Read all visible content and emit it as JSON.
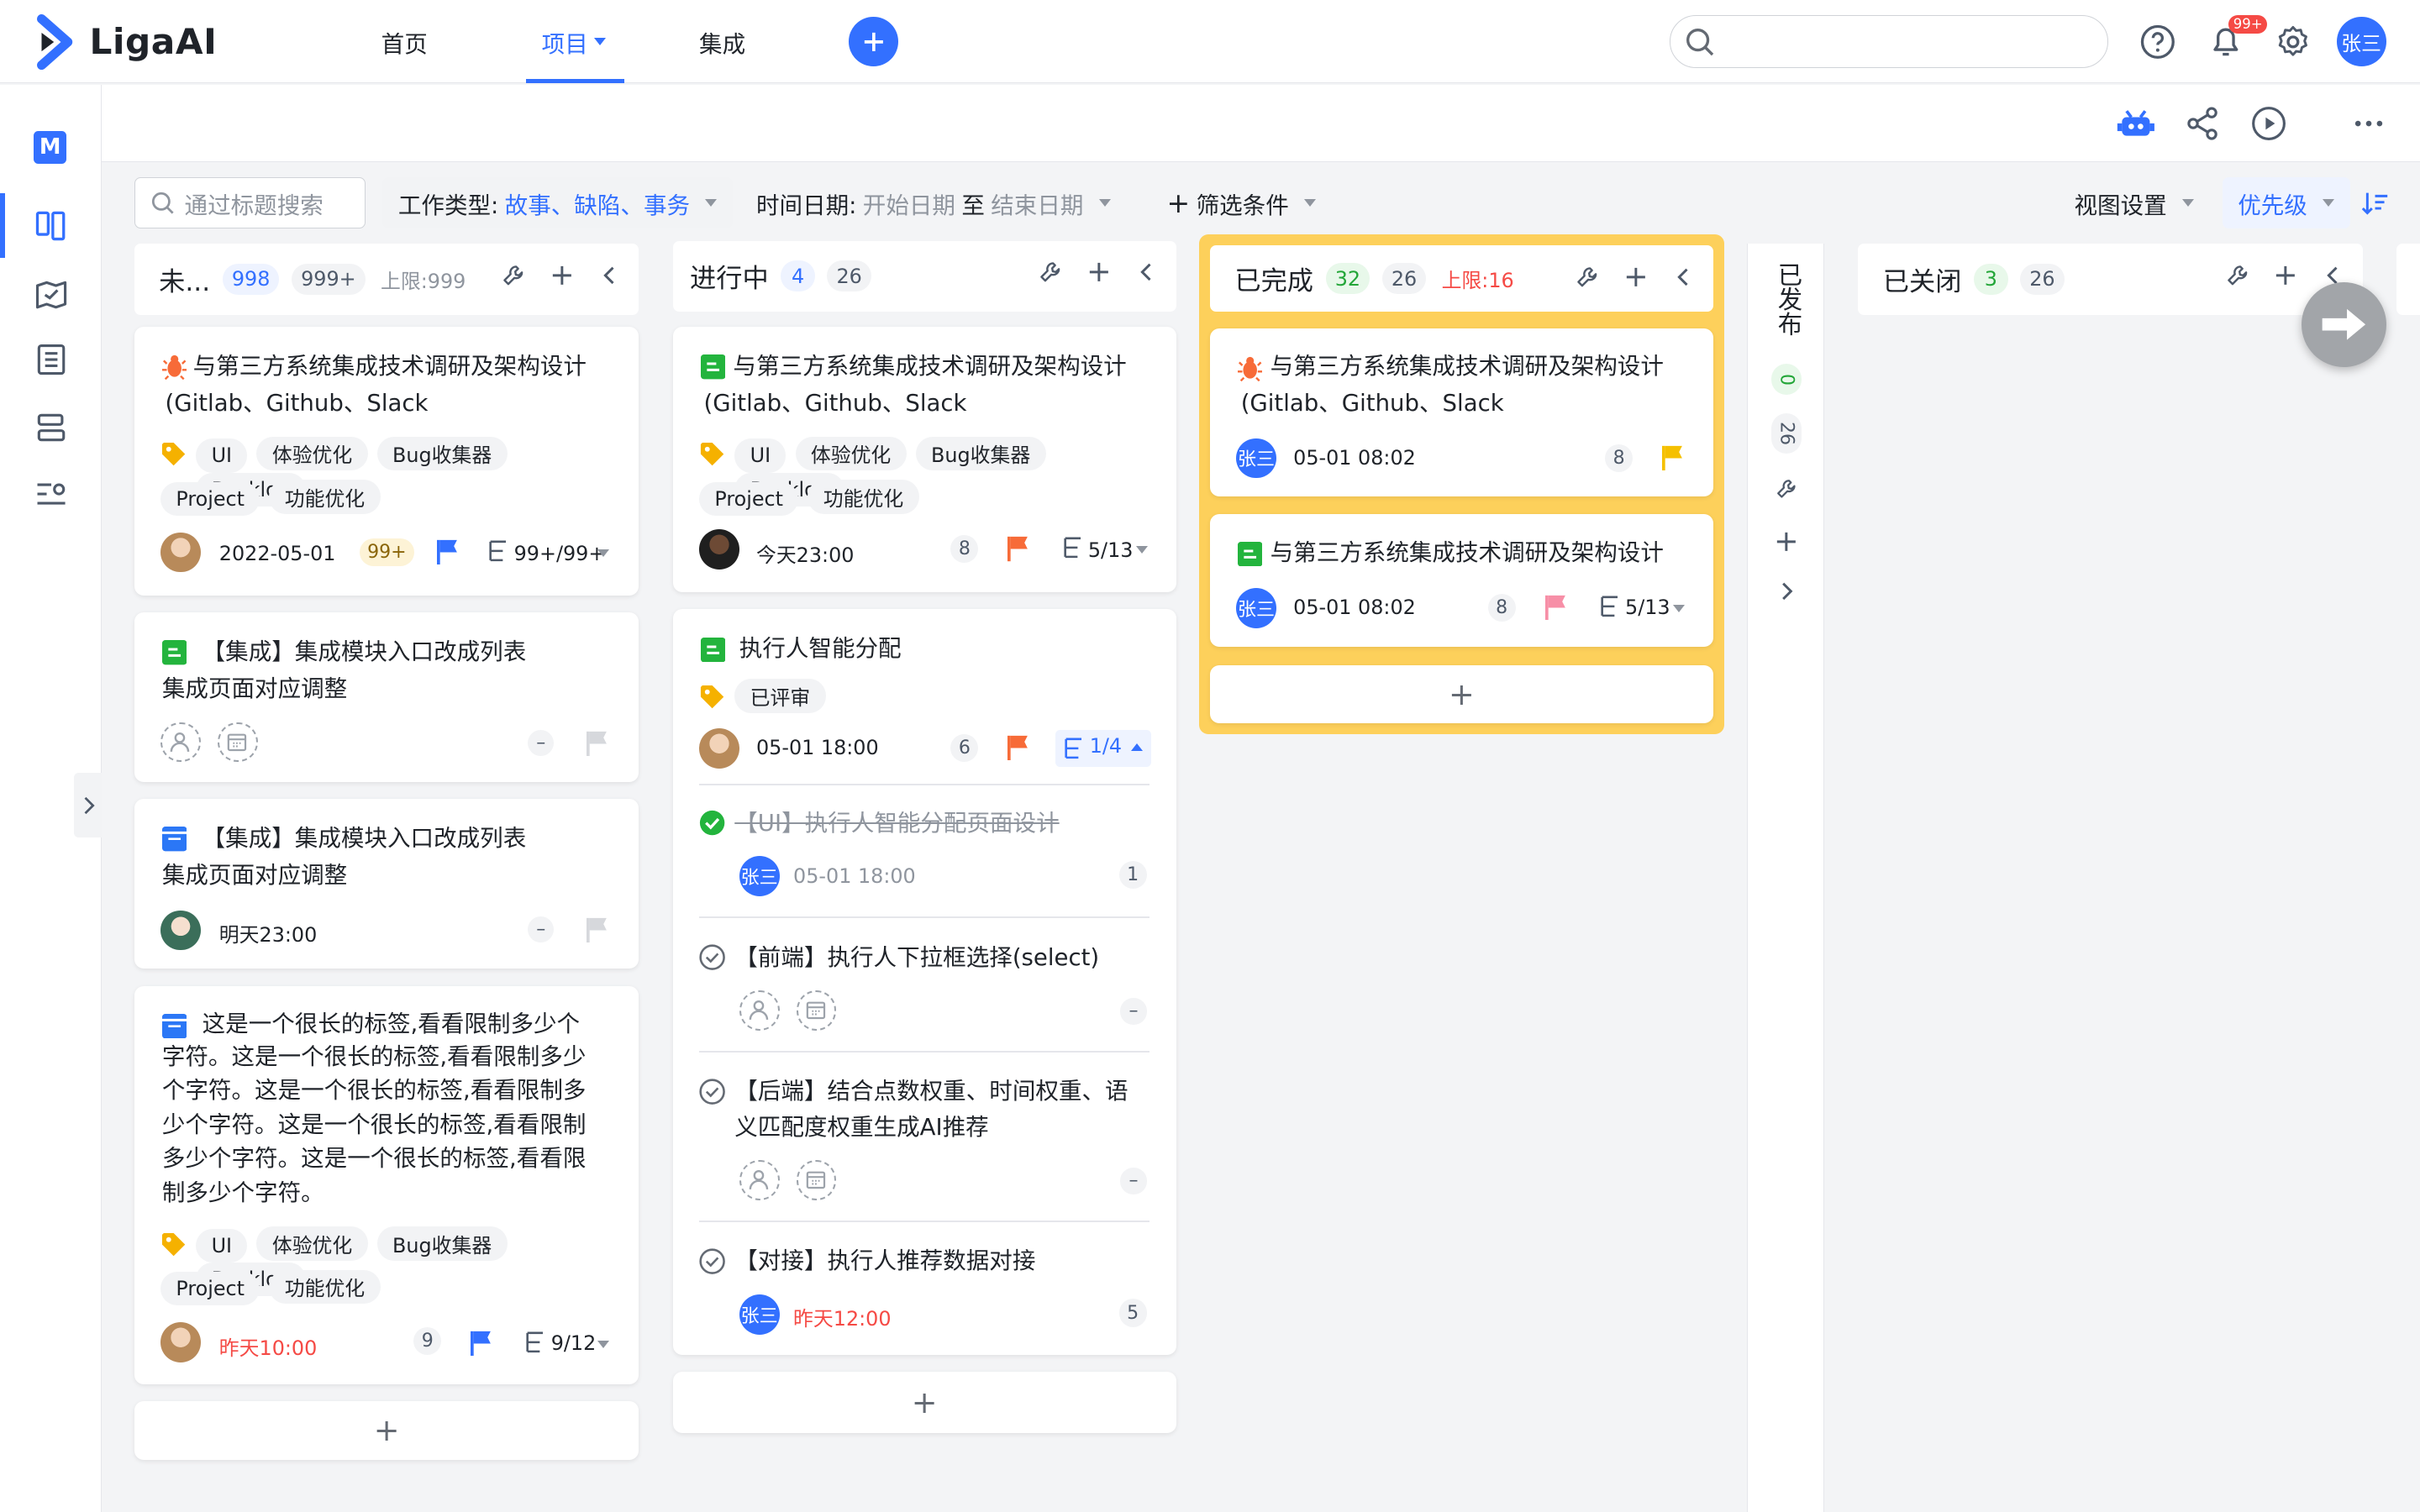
{
  "app": {
    "name": "LigaAI"
  },
  "nav": {
    "home": "首页",
    "project": "项目",
    "integration": "集成"
  },
  "header": {
    "notification_badge": "99+",
    "user_avatar": "张三"
  },
  "rail": {
    "project_badge": "M"
  },
  "filters": {
    "search_placeholder": "通过标题搜索",
    "work_type_label": "工作类型:",
    "work_type_value": "故事、缺陷、事务",
    "date_label": "时间日期:",
    "date_start": "开始日期",
    "date_to": "至",
    "date_end": "结束日期",
    "filter_conditions": "筛选条件",
    "view_settings": "视图设置",
    "sort_priority": "优先级"
  },
  "columns": {
    "todo": {
      "title": "未...",
      "count": "998",
      "count2": "999+",
      "limit": "上限:999"
    },
    "doing": {
      "title": "进行中",
      "count": "4",
      "count2": "26"
    },
    "done": {
      "title": "已完成",
      "count": "32",
      "count2": "26",
      "limit": "上限:16"
    },
    "released": {
      "title": "已发布",
      "count": "0",
      "count2": "26"
    },
    "closed": {
      "title": "已关闭",
      "count": "3",
      "count2": "26"
    }
  },
  "cards": {
    "c1": {
      "title_l1": "与第三方系统集成技术调研及架构设计",
      "title_l2": "(Gitlab、Github、Slack",
      "tags": [
        "UI",
        "体验优化",
        "Bug收集器",
        "Backlog",
        "Project",
        "功能优化"
      ],
      "date": "2022-05-01",
      "badge": "99+",
      "subtasks": "99+/99+"
    },
    "c2": {
      "title_l1": "【集成】集成模块入口改成列表",
      "title_l2": "集成页面对应调整",
      "dash": "–"
    },
    "c3": {
      "title_l1": "【集成】集成模块入口改成列表",
      "title_l2": "集成页面对应调整",
      "date": "明天23:00",
      "dash": "–"
    },
    "c4": {
      "title_lines": [
        "这是一个很长的标签,看看限制多少个",
        "字符。这是一个很长的标签,看看限制多少",
        "个字符。这是一个很长的标签,看看限制多",
        "少个字符。这是一个很长的标签,看看限制",
        "多少个字符。这是一个很长的标签,看看限",
        "制多少个字符。"
      ],
      "tags": [
        "UI",
        "体验优化",
        "Bug收集器",
        "Backlog",
        "Project",
        "功能优化"
      ],
      "date": "昨天10:00",
      "badge": "9",
      "subtasks": "9/12"
    },
    "d1": {
      "title_l1": "与第三方系统集成技术调研及架构设计",
      "title_l2": "(Gitlab、Github、Slack",
      "tags": [
        "UI",
        "体验优化",
        "Bug收集器",
        "Backlog",
        "Project",
        "功能优化"
      ],
      "date": "今天23:00",
      "badge": "8",
      "subtasks": "5/13"
    },
    "d2": {
      "title": "执行人智能分配",
      "tag": "已评审",
      "date": "05-01 18:00",
      "badge": "6",
      "subtasks": "1/4",
      "subs": [
        {
          "title": "【UI】执行人智能分配页面设计",
          "avatar": "张三",
          "date": "05-01 18:00",
          "badge": "1"
        },
        {
          "title": "【前端】执行人下拉框选择(select)",
          "dash": "–"
        },
        {
          "title_l1": "【后端】结合点数权重、时间权重、语",
          "title_l2": "义匹配度权重生成AI推荐",
          "dash": "–"
        },
        {
          "title": "【对接】执行人推荐数据对接",
          "avatar": "张三",
          "date": "昨天12:00",
          "badge": "5"
        }
      ]
    },
    "e1": {
      "title_l1": "与第三方系统集成技术调研及架构设计",
      "title_l2": "(Gitlab、Github、Slack",
      "avatar": "张三",
      "date": "05-01 08:02",
      "badge": "8"
    },
    "e2": {
      "title": "与第三方系统集成技术调研及架构设计",
      "avatar": "张三",
      "date": "05-01 08:02",
      "badge": "8",
      "subtasks": "5/13"
    }
  },
  "add_label": "+",
  "colors": {
    "primary": "#3370ff",
    "done_border": "#fdd05b",
    "bug": "#f76b38",
    "story": "#23b43d",
    "task": "#2b77f6",
    "flag_red": "#f76b38",
    "flag_blue": "#3370ff",
    "flag_yellow": "#f5c000",
    "flag_pink": "#f78fa7",
    "tag_icon": "#f5b100"
  }
}
